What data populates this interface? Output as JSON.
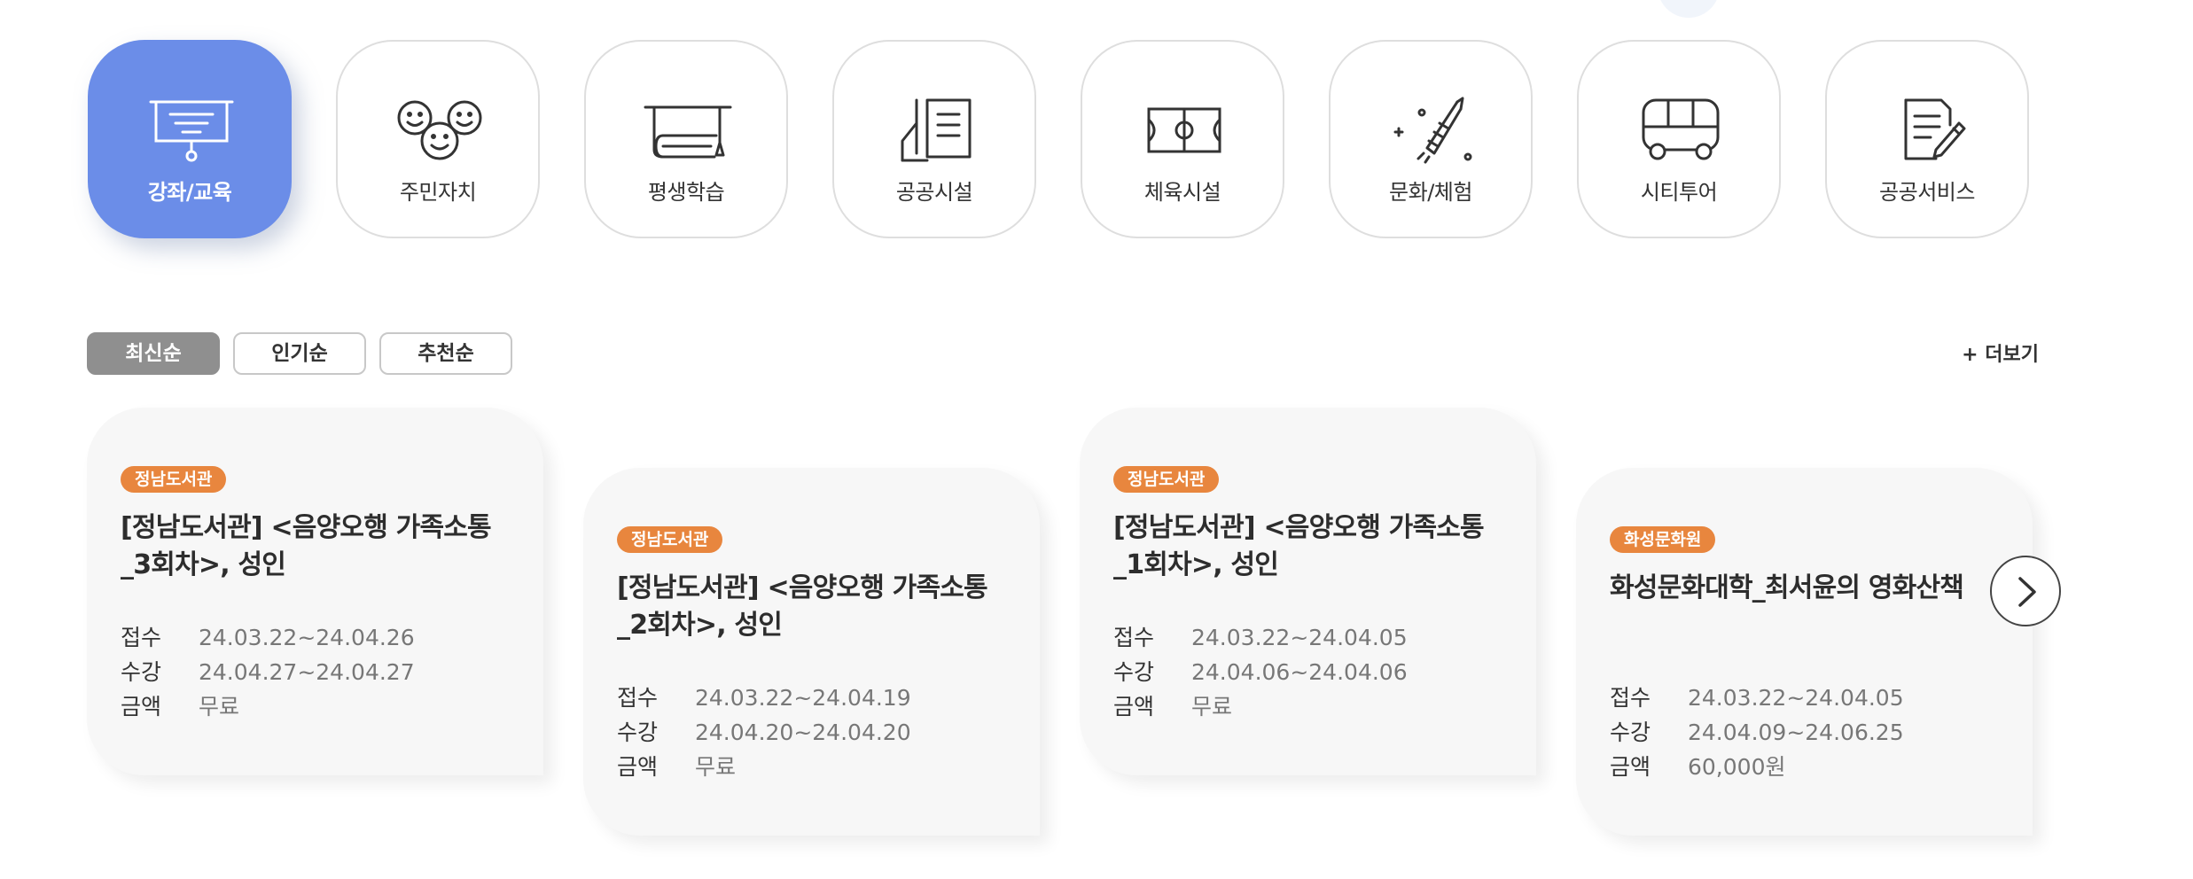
{
  "categories": [
    {
      "label": "강좌/교육",
      "icon": "projector-screen-icon",
      "active": true
    },
    {
      "label": "주민자치",
      "icon": "smiley-faces-icon",
      "active": false
    },
    {
      "label": "평생학습",
      "icon": "scroll-icon",
      "active": false
    },
    {
      "label": "공공시설",
      "icon": "building-document-icon",
      "active": false
    },
    {
      "label": "체육시설",
      "icon": "sports-field-icon",
      "active": false
    },
    {
      "label": "문화/체험",
      "icon": "firework-icon",
      "active": false
    },
    {
      "label": "시티투어",
      "icon": "bus-icon",
      "active": false
    },
    {
      "label": "공공서비스",
      "icon": "document-pen-icon",
      "active": false
    }
  ],
  "sort": {
    "tabs": [
      {
        "label": "최신순",
        "active": true
      },
      {
        "label": "인기순",
        "active": false
      },
      {
        "label": "추천순",
        "active": false
      }
    ],
    "more_label": "+ 더보기"
  },
  "field_labels": {
    "apply": "접수",
    "course": "수강",
    "price": "금액"
  },
  "cards": [
    {
      "tag": "정남도서관",
      "title": "[정남도서관] <음양오행 가족소통_3회차>, 성인",
      "apply": "24.03.22~24.04.26",
      "course": "24.04.27~24.04.27",
      "price": "무료"
    },
    {
      "tag": "정남도서관",
      "title": "[정남도서관] <음양오행 가족소통_2회차>, 성인",
      "apply": "24.03.22~24.04.19",
      "course": "24.04.20~24.04.20",
      "price": "무료"
    },
    {
      "tag": "정남도서관",
      "title": "[정남도서관] <음양오행 가족소통_1회차>, 성인",
      "apply": "24.03.22~24.04.05",
      "course": "24.04.06~24.04.06",
      "price": "무료"
    },
    {
      "tag": "화성문화원",
      "title": "화성문화대학_최서윤의 영화산책",
      "apply": "24.03.22~24.04.05",
      "course": "24.04.09~24.06.25",
      "price": "60,000원"
    }
  ],
  "colors": {
    "accent": "#6b8de8",
    "tag": "#e8863e"
  }
}
